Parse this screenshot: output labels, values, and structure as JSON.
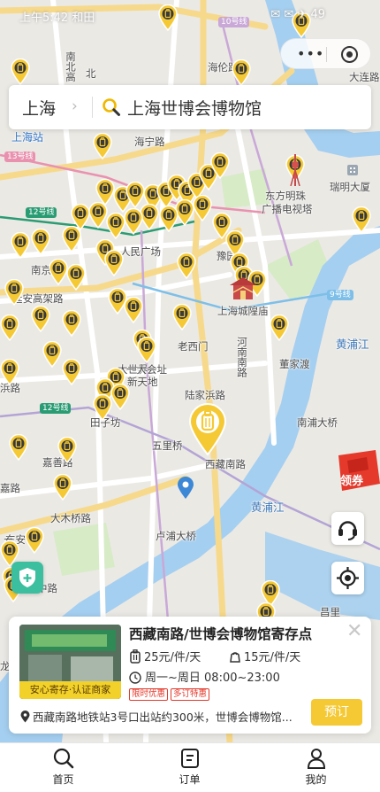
{
  "status_bar": {
    "time": "上午5:42 和田",
    "right": "✉ ✉ ✈ 49"
  },
  "capsule": {
    "dots": "•••"
  },
  "search": {
    "city": "上海",
    "chevron": "›",
    "query": "上海世博会博物馆",
    "icon": "search-icon"
  },
  "map": {
    "places": [
      "大连路",
      "南北高",
      "海伦路",
      "上海站",
      "海宁路",
      "东方明珠",
      "广播电视塔",
      "瑞明大厦",
      "人民广场",
      "豫园",
      "上海城隍庙",
      "老西门",
      "大世界",
      "一大会址",
      "新天地",
      "董家渡",
      "黄浦江",
      "陆家浜路",
      "田子坊",
      "五里桥",
      "西藏南路",
      "南浦大桥",
      "延安高架路",
      "嘉善路",
      "大木桥路",
      "卢浦大桥",
      "黄浦江",
      "昌里",
      "东安",
      "南京",
      "嘉路",
      "东",
      "中路",
      "北",
      "浜路",
      "龙",
      "河南南路"
    ],
    "lines": [
      "10号线",
      "13号线",
      "12号线",
      "9号线",
      "12号线"
    ]
  },
  "coupon": {
    "label": "领券"
  },
  "store": {
    "name": "西藏南路/世博会博物馆寄存点",
    "thumb_badge": "安心寄存·认证商家",
    "price_large": "25元/件/天",
    "price_small": "15元/件/天",
    "hours": "周一~周日 08:00~23:00",
    "tags": [
      "限时优惠",
      "多订特惠"
    ],
    "address": "西藏南路地铁站3号口出站约300米，世博会博物馆...",
    "book_label": "预订",
    "close": "✕"
  },
  "tabs": [
    {
      "label": "首页",
      "icon": "search-icon"
    },
    {
      "label": "订单",
      "icon": "order-icon"
    },
    {
      "label": "我的",
      "icon": "profile-icon"
    }
  ],
  "colors": {
    "accent": "#f5c934",
    "river": "#a5cff0",
    "shield": "#3cbf9f",
    "coupon": "#e4392b"
  }
}
